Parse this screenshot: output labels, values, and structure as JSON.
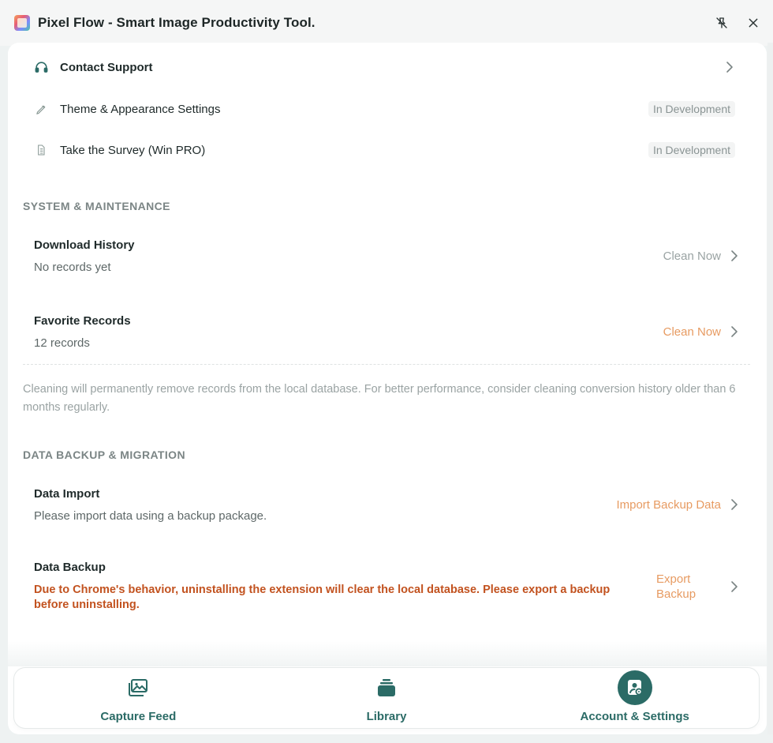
{
  "window": {
    "title": "Pixel Flow - Smart Image Productivity Tool."
  },
  "links": [
    {
      "label": "Contact Support"
    },
    {
      "label": "Theme & Appearance Settings",
      "badge": "In Development"
    },
    {
      "label": "Take the Survey (Win PRO)",
      "badge": "In Development"
    }
  ],
  "system": {
    "title": "SYSTEM & MAINTENANCE",
    "download_history": {
      "title": "Download History",
      "sub": "No records yet",
      "action": "Clean Now"
    },
    "favorite_records": {
      "title": "Favorite Records",
      "sub": "12 records",
      "action": "Clean Now"
    },
    "note": "Cleaning will permanently remove records from the local database. For better performance, consider cleaning conversion history older than 6 months regularly."
  },
  "backup": {
    "title": "DATA BACKUP & MIGRATION",
    "import": {
      "title": "Data Import",
      "sub": "Please import data using a backup package.",
      "action": "Import Backup Data"
    },
    "backup": {
      "title": "Data Backup",
      "warning": "Due to Chrome's behavior, uninstalling the extension will clear the local database. Please export a backup before uninstalling.",
      "action": "Export Backup"
    }
  },
  "nav": [
    {
      "label": "Capture Feed",
      "icon": "image-gallery-icon"
    },
    {
      "label": "Library",
      "icon": "stack-icon"
    },
    {
      "label": "Account & Settings",
      "icon": "account-settings-icon",
      "active": true
    }
  ],
  "colors": {
    "primary": "#2b6b66",
    "accent": "#e79b62",
    "warning": "#c2521f",
    "muted": "#9aa3a3"
  }
}
